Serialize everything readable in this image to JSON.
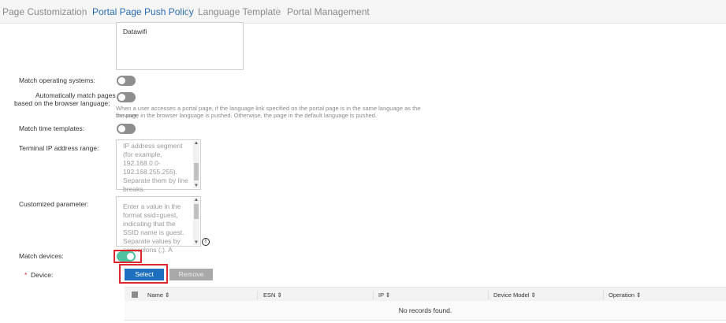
{
  "tabs": [
    {
      "label": "Page Customization",
      "active": false
    },
    {
      "label": "Portal Page Push Policy",
      "active": true
    },
    {
      "label": "Language Template",
      "active": false
    },
    {
      "label": "Portal Management",
      "active": false
    }
  ],
  "top_box": {
    "value": "Datawifi"
  },
  "fields": {
    "match_os": {
      "label": "Match operating systems:",
      "enabled": false
    },
    "auto_lang": {
      "label_line1": "Automatically match pages",
      "label_line2": "based on the browser language:",
      "enabled": false,
      "hint_line1": "When a user accesses a portal page, if the language link specified on the portal page is in the same language as the browser,",
      "hint_line2": "the page in the browser language is pushed. Otherwise, the page in the default language is pushed."
    },
    "match_time": {
      "label": "Match time templates:",
      "enabled": false
    },
    "terminal_ip": {
      "label": "Terminal IP address range:",
      "placeholder": "IP address segment\n(for example,\n192.168.0.0-\n192.168.255.255).\nSeparate them by line\nbreaks."
    },
    "custom_param": {
      "label": "Customized parameter:",
      "placeholder": "Enter a value in the\nformat ssid=guest,\nindicating that the\nSSID name is guest.\nSeparate values by\nsemicolons (;). A"
    },
    "match_devices": {
      "label": "Match devices:",
      "enabled": true
    },
    "device": {
      "required_mark": "*",
      "label": "Device:"
    }
  },
  "buttons": {
    "select": "Select",
    "remove": "Remove"
  },
  "table": {
    "columns": [
      "Name",
      "ESN",
      "IP",
      "Device Model",
      "Operation"
    ],
    "sort_glyph": "⇕",
    "empty_text": "No records found."
  },
  "colors": {
    "accent": "#1e6fbf",
    "toggle_on": "#4fc3a1",
    "highlight": "#e0262d"
  }
}
